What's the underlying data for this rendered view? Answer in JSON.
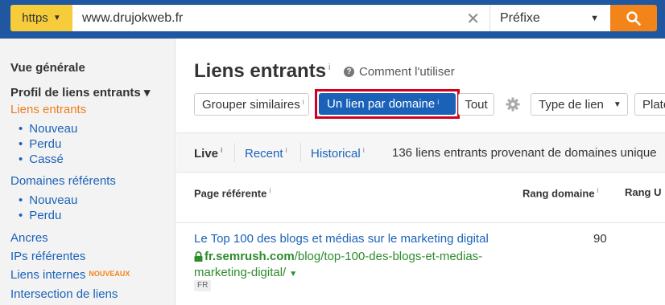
{
  "search": {
    "protocol": "https",
    "url": "www.drujokweb.fr",
    "mode": "Préfixe"
  },
  "sidebar": {
    "overview": "Vue générale",
    "profile_heading": "Profil de liens entrants ▾",
    "backlinks": "Liens entrants",
    "backlinks_sub": [
      "Nouveau",
      "Perdu",
      "Cassé"
    ],
    "ref_domains": "Domaines référents",
    "ref_domains_sub": [
      "Nouveau",
      "Perdu"
    ],
    "anchors": "Ancres",
    "ref_ips": "IPs référentes",
    "internal_links": "Liens internes",
    "internal_links_badge": "NOUVEAUX",
    "link_intersect": "Intersection de liens"
  },
  "main": {
    "title": "Liens entrants",
    "info_mark": "i",
    "howto": "Comment l'utiliser",
    "toolbar": {
      "group_similar": "Grouper similaires",
      "one_per_domain": "Un lien par domaine",
      "all": "Tout",
      "link_type": "Type de lien",
      "platform": "Plate"
    },
    "tabs": {
      "live": "Live",
      "recent": "Recent",
      "historical": "Historical",
      "summary": "136 liens entrants provenant de domaines unique"
    },
    "columns": {
      "referring_page": "Page référente",
      "domain_rank": "Rang domaine",
      "url_rank": "Rang U"
    },
    "rows": [
      {
        "title": "Le Top 100 des blogs et médias sur le marketing digital",
        "domain": "fr.semrush.com",
        "path": "/blog/top-100-des-blogs-et-medias-marketing-digital/",
        "lang": "FR",
        "domain_rank": "90"
      }
    ]
  },
  "colors": {
    "topbar": "#1f58a0",
    "protocol_bg": "#f7cc3a",
    "search_button": "#f2841a",
    "link": "#1a62b8",
    "active": "#ef7d1a",
    "highlight_frame": "#d0021b",
    "url_green": "#2e8b2e"
  }
}
